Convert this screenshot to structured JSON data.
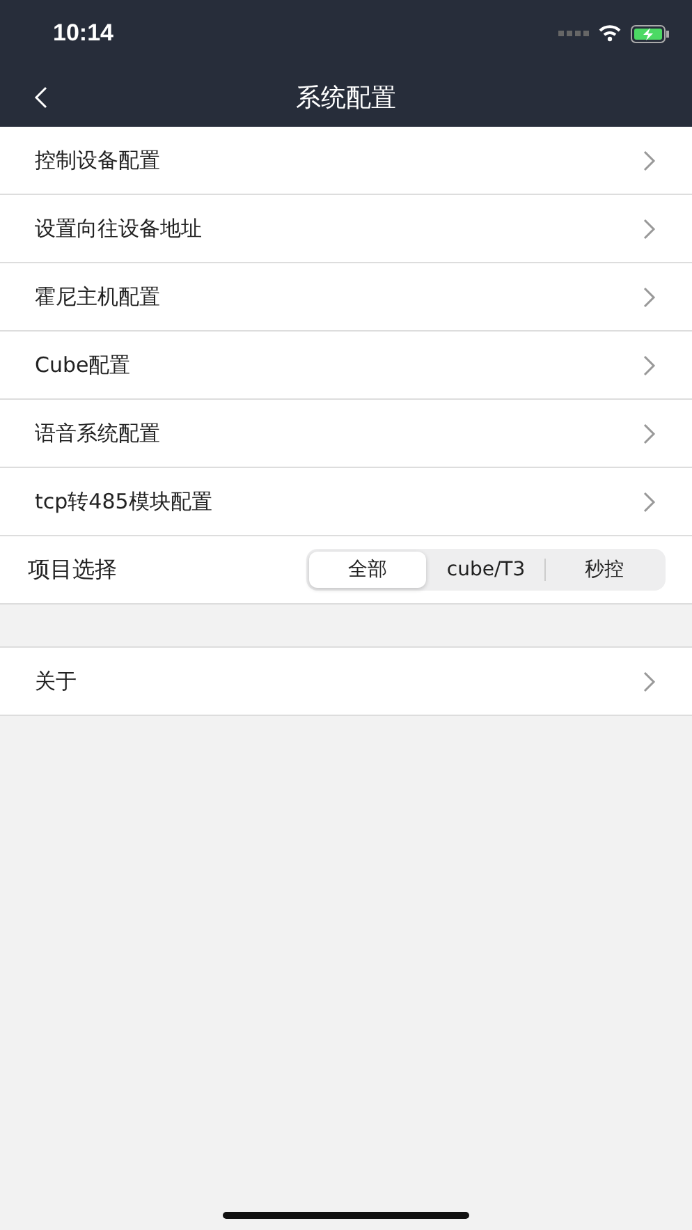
{
  "status_bar": {
    "time": "10:14"
  },
  "nav_bar": {
    "title": "系统配置"
  },
  "menu": [
    {
      "label": "控制设备配置"
    },
    {
      "label": "设置向往设备地址"
    },
    {
      "label": "霍尼主机配置"
    },
    {
      "label": "Cube配置"
    },
    {
      "label": "语音系统配置"
    },
    {
      "label": "tcp转485模块配置"
    }
  ],
  "project_select": {
    "label": "项目选择",
    "options": [
      {
        "label": "全部",
        "selected": true
      },
      {
        "label": "cube/T3",
        "selected": false
      },
      {
        "label": "秒控",
        "selected": false
      }
    ]
  },
  "about": {
    "label": "关于"
  }
}
